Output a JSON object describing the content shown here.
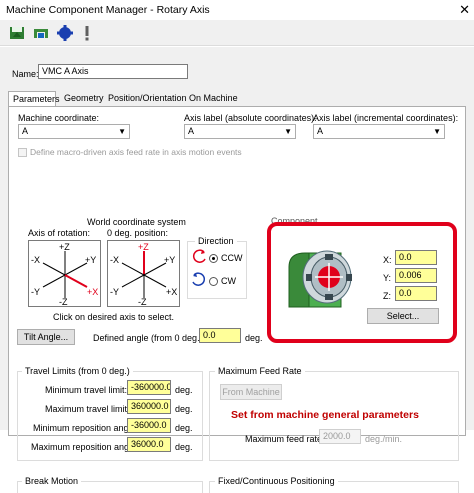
{
  "window": {
    "title": "Machine Component Manager - Rotary Axis",
    "close_glyph": "✕"
  },
  "toolbar": {
    "icons": [
      "save-icon",
      "component-icon",
      "axis-icon",
      "warning-icon"
    ]
  },
  "name_field": {
    "label": "Name:",
    "value": "VMC A Axis"
  },
  "tabs": [
    {
      "label": "Parameters",
      "active": true
    },
    {
      "label": "Geometry",
      "active": false
    },
    {
      "label": "Position/Orientation On Machine",
      "active": false
    }
  ],
  "params": {
    "machine_coordinate": {
      "label": "Machine coordinate:",
      "value": "A"
    },
    "axis_label_abs": {
      "label": "Axis label (absolute coordinates):",
      "value": "A"
    },
    "axis_label_inc": {
      "label": "Axis label (incremental coordinates):",
      "value": "A"
    },
    "macro_checkbox": {
      "label": "Define macro-driven axis feed rate in axis motion events",
      "checked": false
    }
  },
  "wcs": {
    "title": "World coordinate system",
    "axis_of_rotation_label": "Axis of rotation:",
    "zero_position_label": "0 deg. position:",
    "axis_box1": {
      "pz": "+Z",
      "py": "+Y",
      "mx": "-X",
      "px": "+X",
      "my": "-Y",
      "mz": "-Z"
    },
    "axis_box2": {
      "pz": "+Z",
      "py": "+Y",
      "mx": "-X",
      "px": "+X",
      "my": "-Y",
      "mz": "-Z"
    },
    "hint": "Click on desired axis to select."
  },
  "direction": {
    "title": "Direction",
    "ccw": "CCW",
    "cw": "CW",
    "selected": "CCW"
  },
  "component": {
    "title": "Component",
    "x_label": "X:",
    "x_value": "0.0",
    "y_label": "Y:",
    "y_value": "0.006",
    "z_label": "Z:",
    "z_value": "0.0",
    "select_button": "Select..."
  },
  "tilt": {
    "button": "Tilt Angle...",
    "defined_label": "Defined angle (from 0 deg.):",
    "value": "0.0",
    "unit": "deg."
  },
  "travel": {
    "title": "Travel Limits (from 0 deg.)",
    "rows": [
      {
        "label": "Minimum travel limit:",
        "value": "-360000.0",
        "unit": "deg."
      },
      {
        "label": "Maximum travel limit:",
        "value": "360000.0",
        "unit": "deg."
      },
      {
        "label": "Minimum reposition angle:",
        "value": "-36000.0",
        "unit": "deg."
      },
      {
        "label": "Maximum reposition angle:",
        "value": "36000.0",
        "unit": "deg."
      }
    ]
  },
  "feed": {
    "title": "Maximum Feed Rate",
    "from_machine_button": "From Machine",
    "note": "Set from machine general parameters",
    "max_label": "Maximum feed rate:",
    "max_value": "2000.0",
    "unit": "deg./min."
  },
  "bottom": {
    "break_motion": "Break Motion",
    "fixed_positioning": "Fixed/Continuous Positioning"
  },
  "colors": {
    "highlight": "#e0001b",
    "yellow_field": "#ffff99",
    "note": "#c00000",
    "machine_green": "#3a8a3a"
  }
}
